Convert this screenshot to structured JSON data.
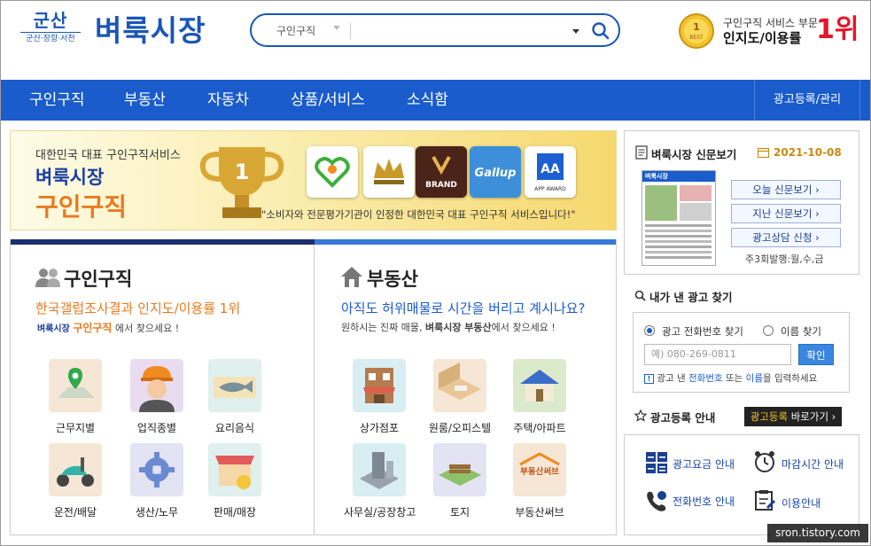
{
  "header": {
    "logo_main": "군산",
    "logo_sub": "군산·장항·서천",
    "brand": "벼룩시장",
    "search_category": "구인구직",
    "search_value": "",
    "best_badge": "BEST",
    "rank_line1": "구인구직 서비스 부문",
    "rank_line2": "인지도/이용률",
    "rank_num": "1위"
  },
  "nav": {
    "items": [
      "구인구직",
      "부동산",
      "자동차",
      "상품/서비스",
      "소식함"
    ],
    "right": "광고등록/관리"
  },
  "banner": {
    "line1": "대한민국 대표 구인구직서비스",
    "line2": "벼룩시장",
    "line3": "구인구직",
    "awards": [
      "BRAND",
      "Gallup",
      "APP AWARD"
    ],
    "quote": "\"소비자와 전문평가기관이 인정한 대한민국 대표 구인구직 서비스입니다!\""
  },
  "jobs": {
    "title": "구인구직",
    "sub": "한국갤럽조사결과 인지도/이용률 1위",
    "small_brand": "벼룩시장",
    "small_tag": "구인구직",
    "small_tail": "에서 찾으세요 !",
    "categories": [
      "근무지별",
      "업직종별",
      "요리음식",
      "운전/배달",
      "생산/노무",
      "판매/매장"
    ]
  },
  "realty": {
    "title": "부동산",
    "sub": "아직도 허위매물로 시간을 버리고 계시나요?",
    "small_pre": "원하시는 진짜 매물,",
    "small_bold": "벼룩시장 부동산",
    "small_tail": "에서 찾으세요 !",
    "categories": [
      "상가점포",
      "원룸/오피스텔",
      "주택/아파트",
      "사무실/공장창고",
      "토지",
      "부동산써브"
    ],
    "serve_logo": "부동산써브"
  },
  "newspaper": {
    "title": "벼룩시장 신문보기",
    "date": "2021-10-08",
    "paper_title": "벼룩시장",
    "buttons": [
      "오늘 신문보기 ›",
      "지난 신문보기 ›",
      "광고상담 신청 ›"
    ],
    "days": "주3회발행:월,수,금"
  },
  "find": {
    "title": "내가 낸 광고 찾기",
    "radio1": "광고 전화번호 찾기",
    "radio2": "이름 찾기",
    "placeholder": "예) 080-269-0811",
    "button": "확인",
    "note_pre": "광고 낸",
    "note_phone": "전화번호",
    "note_mid": "또는",
    "note_name": "이름",
    "note_tail": "을 입력하세요"
  },
  "ad": {
    "title": "광고등록 안내",
    "button_accent": "광고등록",
    "button_rest": "바로가기 ›",
    "items": [
      "광고요금 안내",
      "마감시간 안내",
      "전화번호 안내",
      "이용안내"
    ]
  },
  "watermark": "sron.tistory.com",
  "colors": {
    "brand_blue": "#1a5ccc",
    "accent_orange": "#e97a1e",
    "rank_red": "#e2162b",
    "date_gold": "#c98a12"
  }
}
